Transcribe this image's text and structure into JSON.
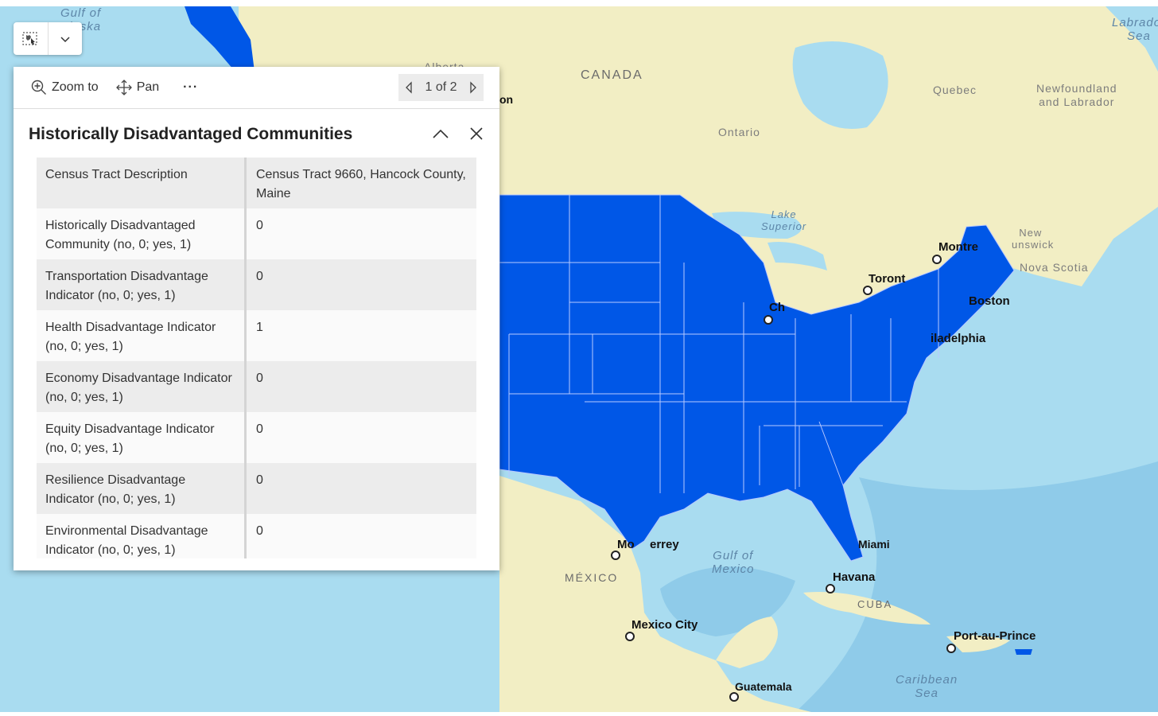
{
  "map": {
    "colors": {
      "ocean": "#a9dcf0",
      "deep_ocean": "#8fcbe9",
      "land": "#f2eec4",
      "highlight": "#0057e7",
      "state_border": "#b8c8ff"
    },
    "country_labels": [
      "CANADA",
      "MÉXICO",
      "CUBA"
    ],
    "region_labels": [
      "Alberta",
      "Quebec",
      "Ontario",
      "Newfoundland",
      "and Labrador",
      "New",
      "unswick",
      "Nova Scotia"
    ],
    "water_labels": [
      "Gulf of",
      "Alaska",
      "Labrador",
      "Sea",
      "Lake",
      "Superior",
      "Gulf of",
      "Mexico",
      "Caribbean",
      "Sea"
    ],
    "city_labels": [
      "Montre",
      "Toront",
      "Ch",
      "Boston",
      "iladelphia",
      "Miami",
      "Havana",
      "Mexico City",
      "Port-au-Prince",
      "Guatemala",
      "Mo",
      "errey",
      "on"
    ]
  },
  "toolbar": {
    "select_icon": "select-tool-icon",
    "dropdown_icon": "chevron-down-icon"
  },
  "popup": {
    "actions": [
      {
        "icon": "zoom-in-icon",
        "label": "Zoom to"
      },
      {
        "icon": "pan-icon",
        "label": "Pan"
      },
      {
        "icon": "more-icon",
        "label": "···"
      }
    ],
    "pager": {
      "label": "1 of 2"
    },
    "title": "Historically Disadvantaged Communities",
    "fields": [
      {
        "name": "Census Tract Description",
        "value": "Census Tract 9660, Hancock County, Maine"
      },
      {
        "name": "Historically Disadvantaged Community (no, 0; yes, 1)",
        "value": "0"
      },
      {
        "name": "Transportation Disadvantage Indicator (no, 0; yes, 1)",
        "value": "0"
      },
      {
        "name": "Health Disadvantage Indicator (no, 0; yes, 1)",
        "value": "1"
      },
      {
        "name": "Economy Disadvantage Indicator (no, 0; yes, 1)",
        "value": "0"
      },
      {
        "name": "Equity Disadvantage Indicator (no, 0; yes, 1)",
        "value": "0"
      },
      {
        "name": "Resilience Disadvantage Indicator (no, 0; yes, 1)",
        "value": "0"
      },
      {
        "name": "Environmental Disadvantage Indicator (no, 0; yes, 1)",
        "value": "0"
      }
    ]
  }
}
